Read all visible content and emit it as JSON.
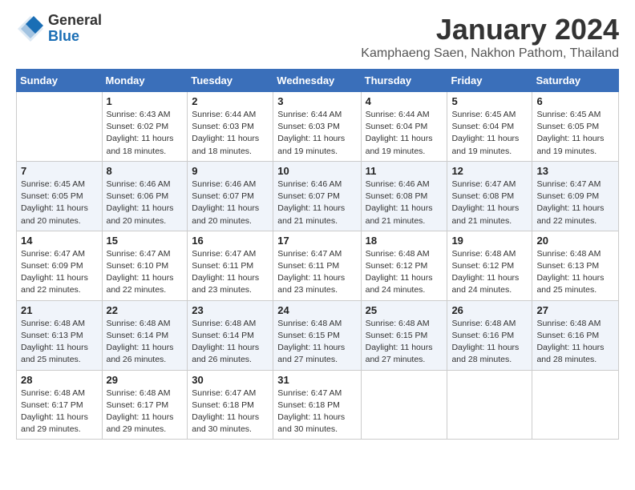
{
  "header": {
    "logo_general": "General",
    "logo_blue": "Blue",
    "month_title": "January 2024",
    "location": "Kamphaeng Saen, Nakhon Pathom, Thailand"
  },
  "days_of_week": [
    "Sunday",
    "Monday",
    "Tuesday",
    "Wednesday",
    "Thursday",
    "Friday",
    "Saturday"
  ],
  "weeks": [
    [
      {
        "day": "",
        "sunrise": "",
        "sunset": "",
        "daylight": ""
      },
      {
        "day": "1",
        "sunrise": "6:43 AM",
        "sunset": "6:02 PM",
        "daylight": "11 hours and 18 minutes."
      },
      {
        "day": "2",
        "sunrise": "6:44 AM",
        "sunset": "6:03 PM",
        "daylight": "11 hours and 18 minutes."
      },
      {
        "day": "3",
        "sunrise": "6:44 AM",
        "sunset": "6:03 PM",
        "daylight": "11 hours and 19 minutes."
      },
      {
        "day": "4",
        "sunrise": "6:44 AM",
        "sunset": "6:04 PM",
        "daylight": "11 hours and 19 minutes."
      },
      {
        "day": "5",
        "sunrise": "6:45 AM",
        "sunset": "6:04 PM",
        "daylight": "11 hours and 19 minutes."
      },
      {
        "day": "6",
        "sunrise": "6:45 AM",
        "sunset": "6:05 PM",
        "daylight": "11 hours and 19 minutes."
      }
    ],
    [
      {
        "day": "7",
        "sunrise": "6:45 AM",
        "sunset": "6:05 PM",
        "daylight": "11 hours and 20 minutes."
      },
      {
        "day": "8",
        "sunrise": "6:46 AM",
        "sunset": "6:06 PM",
        "daylight": "11 hours and 20 minutes."
      },
      {
        "day": "9",
        "sunrise": "6:46 AM",
        "sunset": "6:07 PM",
        "daylight": "11 hours and 20 minutes."
      },
      {
        "day": "10",
        "sunrise": "6:46 AM",
        "sunset": "6:07 PM",
        "daylight": "11 hours and 21 minutes."
      },
      {
        "day": "11",
        "sunrise": "6:46 AM",
        "sunset": "6:08 PM",
        "daylight": "11 hours and 21 minutes."
      },
      {
        "day": "12",
        "sunrise": "6:47 AM",
        "sunset": "6:08 PM",
        "daylight": "11 hours and 21 minutes."
      },
      {
        "day": "13",
        "sunrise": "6:47 AM",
        "sunset": "6:09 PM",
        "daylight": "11 hours and 22 minutes."
      }
    ],
    [
      {
        "day": "14",
        "sunrise": "6:47 AM",
        "sunset": "6:09 PM",
        "daylight": "11 hours and 22 minutes."
      },
      {
        "day": "15",
        "sunrise": "6:47 AM",
        "sunset": "6:10 PM",
        "daylight": "11 hours and 22 minutes."
      },
      {
        "day": "16",
        "sunrise": "6:47 AM",
        "sunset": "6:11 PM",
        "daylight": "11 hours and 23 minutes."
      },
      {
        "day": "17",
        "sunrise": "6:47 AM",
        "sunset": "6:11 PM",
        "daylight": "11 hours and 23 minutes."
      },
      {
        "day": "18",
        "sunrise": "6:48 AM",
        "sunset": "6:12 PM",
        "daylight": "11 hours and 24 minutes."
      },
      {
        "day": "19",
        "sunrise": "6:48 AM",
        "sunset": "6:12 PM",
        "daylight": "11 hours and 24 minutes."
      },
      {
        "day": "20",
        "sunrise": "6:48 AM",
        "sunset": "6:13 PM",
        "daylight": "11 hours and 25 minutes."
      }
    ],
    [
      {
        "day": "21",
        "sunrise": "6:48 AM",
        "sunset": "6:13 PM",
        "daylight": "11 hours and 25 minutes."
      },
      {
        "day": "22",
        "sunrise": "6:48 AM",
        "sunset": "6:14 PM",
        "daylight": "11 hours and 26 minutes."
      },
      {
        "day": "23",
        "sunrise": "6:48 AM",
        "sunset": "6:14 PM",
        "daylight": "11 hours and 26 minutes."
      },
      {
        "day": "24",
        "sunrise": "6:48 AM",
        "sunset": "6:15 PM",
        "daylight": "11 hours and 27 minutes."
      },
      {
        "day": "25",
        "sunrise": "6:48 AM",
        "sunset": "6:15 PM",
        "daylight": "11 hours and 27 minutes."
      },
      {
        "day": "26",
        "sunrise": "6:48 AM",
        "sunset": "6:16 PM",
        "daylight": "11 hours and 28 minutes."
      },
      {
        "day": "27",
        "sunrise": "6:48 AM",
        "sunset": "6:16 PM",
        "daylight": "11 hours and 28 minutes."
      }
    ],
    [
      {
        "day": "28",
        "sunrise": "6:48 AM",
        "sunset": "6:17 PM",
        "daylight": "11 hours and 29 minutes."
      },
      {
        "day": "29",
        "sunrise": "6:48 AM",
        "sunset": "6:17 PM",
        "daylight": "11 hours and 29 minutes."
      },
      {
        "day": "30",
        "sunrise": "6:47 AM",
        "sunset": "6:18 PM",
        "daylight": "11 hours and 30 minutes."
      },
      {
        "day": "31",
        "sunrise": "6:47 AM",
        "sunset": "6:18 PM",
        "daylight": "11 hours and 30 minutes."
      },
      {
        "day": "",
        "sunrise": "",
        "sunset": "",
        "daylight": ""
      },
      {
        "day": "",
        "sunrise": "",
        "sunset": "",
        "daylight": ""
      },
      {
        "day": "",
        "sunrise": "",
        "sunset": "",
        "daylight": ""
      }
    ]
  ],
  "labels": {
    "sunrise_prefix": "Sunrise: ",
    "sunset_prefix": "Sunset: ",
    "daylight_prefix": "Daylight: "
  }
}
